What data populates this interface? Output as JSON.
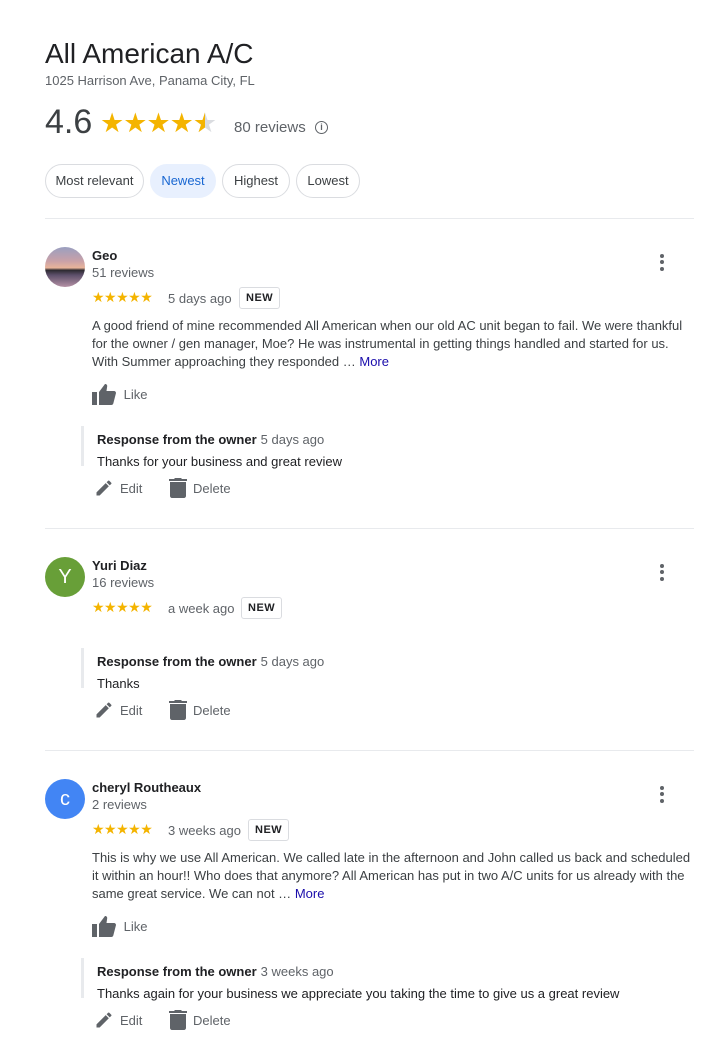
{
  "business": {
    "name": "All American A/C",
    "address": "1025 Harrison Ave, Panama City, FL",
    "rating": "4.6",
    "review_count": "80 reviews"
  },
  "sort_chips": [
    "Most relevant",
    "Newest",
    "Highest",
    "Lowest"
  ],
  "active_sort": "Newest",
  "colors": {
    "star": "#f4b400",
    "link": "#1a0dab",
    "chip_active_bg": "#e8f0fe",
    "chip_active_text": "#1967d2"
  },
  "reviews": [
    {
      "name": "Geo",
      "count": "51 reviews",
      "stars": 5,
      "time": "5 days ago",
      "badge": "NEW",
      "avatar": {
        "type": "photo"
      },
      "text_lines": [
        "A good friend of mine recommended All American when our old AC unit began to fail. We were thankful",
        "for the owner / gen manager, Moe? He was instrumental in getting things handled and started for us.",
        "With Summer approaching they responded …"
      ],
      "more": "More",
      "like": "Like",
      "owner_label": "Response from the owner",
      "owner_time": "5 days ago",
      "owner_text": "Thanks for your business and great review",
      "edit": "Edit",
      "delete": "Delete"
    },
    {
      "name": "Yuri Diaz",
      "count": "16 reviews",
      "stars": 5,
      "time": "a week ago",
      "badge": "NEW",
      "avatar": {
        "type": "letter",
        "letter": "Y",
        "color": "#689f38"
      },
      "owner_label": "Response from the owner",
      "owner_time": "5 days ago",
      "owner_text": "Thanks",
      "edit": "Edit",
      "delete": "Delete"
    },
    {
      "name": "cheryl Routheaux",
      "count": "2 reviews",
      "stars": 5,
      "time": "3 weeks ago",
      "badge": "NEW",
      "avatar": {
        "type": "letter",
        "letter": "c",
        "color": "#4285f4"
      },
      "text_lines": [
        "This is why we use All American. We called late in the afternoon and John called us back and scheduled",
        "it within an hour!!  Who does that anymore?  All American has put in two A/C units for us already with the",
        "same great service. We can not …"
      ],
      "more": "More",
      "like": "Like",
      "owner_label": "Response from the owner",
      "owner_time": "3 weeks ago",
      "owner_text": "Thanks again for your business we appreciate you taking the time to give us a great review",
      "edit": "Edit",
      "delete": "Delete"
    }
  ]
}
